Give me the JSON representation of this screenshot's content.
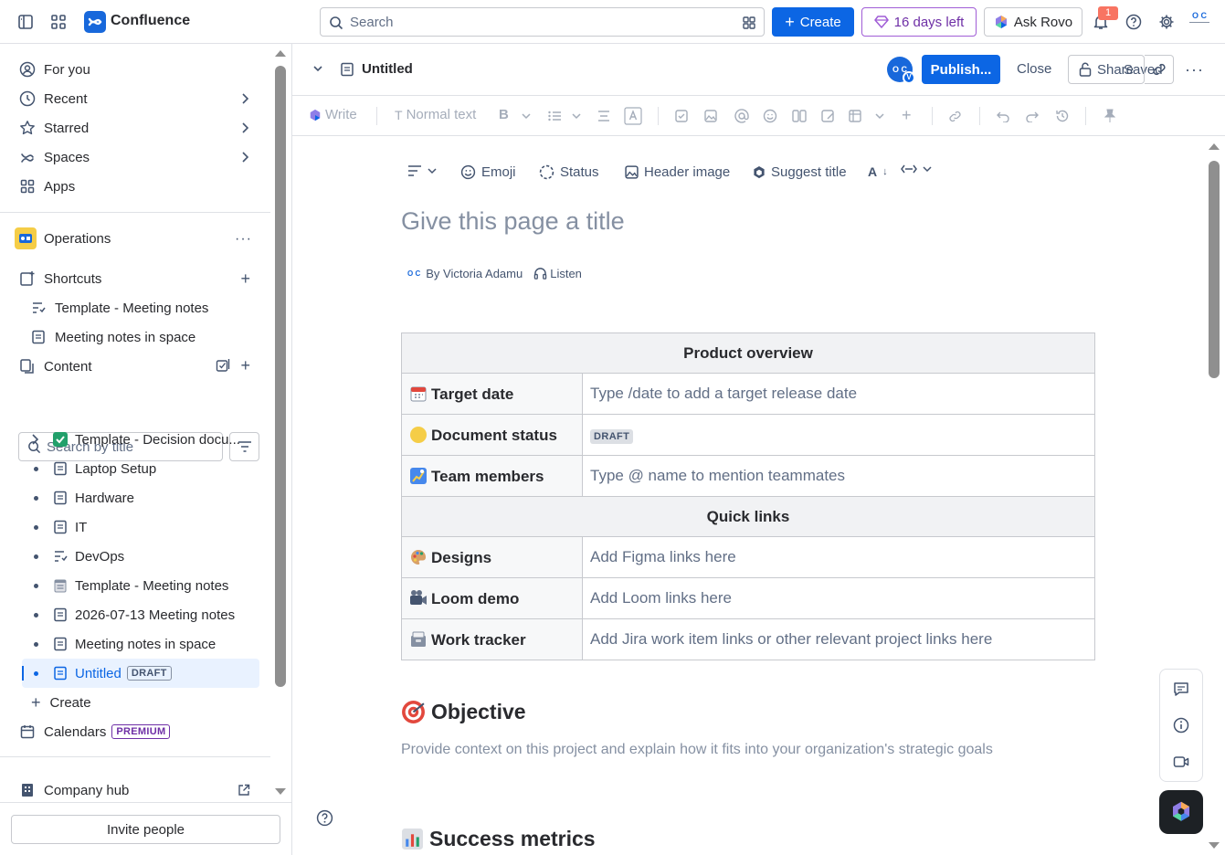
{
  "topbar": {
    "app_name": "Confluence",
    "search_placeholder": "Search",
    "create_label": "Create",
    "trial_label": "16 days left",
    "rovo_label": "Ask Rovo",
    "notification_count": "1",
    "avatar_initials": "O C"
  },
  "sidebar": {
    "nav": [
      {
        "label": "For you"
      },
      {
        "label": "Recent"
      },
      {
        "label": "Starred"
      },
      {
        "label": "Spaces"
      },
      {
        "label": "Apps"
      }
    ],
    "space_name": "Operations",
    "shortcuts_label": "Shortcuts",
    "shortcuts": [
      {
        "label": "Template - Meeting notes"
      },
      {
        "label": "Meeting notes in space"
      }
    ],
    "content_label": "Content",
    "search_placeholder": "Search by title",
    "tree": [
      {
        "label": "Template - Decision docu..."
      },
      {
        "label": "Laptop Setup"
      },
      {
        "label": "Hardware"
      },
      {
        "label": "IT"
      },
      {
        "label": "DevOps"
      },
      {
        "label": "Template - Meeting notes"
      },
      {
        "label": "2026-07-13 Meeting notes"
      },
      {
        "label": "Meeting notes in space"
      },
      {
        "label": "Untitled",
        "badge": "DRAFT"
      }
    ],
    "create_label": "Create",
    "calendars_label": "Calendars",
    "calendars_badge": "PREMIUM",
    "company_hub_label": "Company hub",
    "invite_label": "Invite people"
  },
  "page_header": {
    "title": "Untitled",
    "saved_label": "Saved",
    "avatar_badge": "V",
    "publish_label": "Publish...",
    "close_label": "Close",
    "share_label": "Share"
  },
  "toolbar": {
    "write_label": "Write",
    "text_style_label": "Normal text"
  },
  "page_tools": {
    "emoji_label": "Emoji",
    "status_label": "Status",
    "header_image_label": "Header image",
    "suggest_title_label": "Suggest title"
  },
  "editor": {
    "title_placeholder": "Give this page a title",
    "byline": "By Victoria Adamu",
    "listen_label": "Listen",
    "table": {
      "header1": "Product overview",
      "rows1": [
        {
          "key": "Target date",
          "value": "Type /date to add a target release date"
        },
        {
          "key": "Document status",
          "value": "DRAFT"
        },
        {
          "key": "Team members",
          "value": "Type @ name to mention teammates"
        }
      ],
      "header2": "Quick links",
      "rows2": [
        {
          "key": "Designs",
          "value": "Add Figma links here"
        },
        {
          "key": "Loom demo",
          "value": "Add Loom links here"
        },
        {
          "key": "Work tracker",
          "value": "Add Jira work item links or other relevant project links here"
        }
      ]
    },
    "objective_heading": "Objective",
    "objective_text": "Provide context on this project and explain how it fits into your organization's strategic goals",
    "metrics_heading": "Success metrics"
  }
}
